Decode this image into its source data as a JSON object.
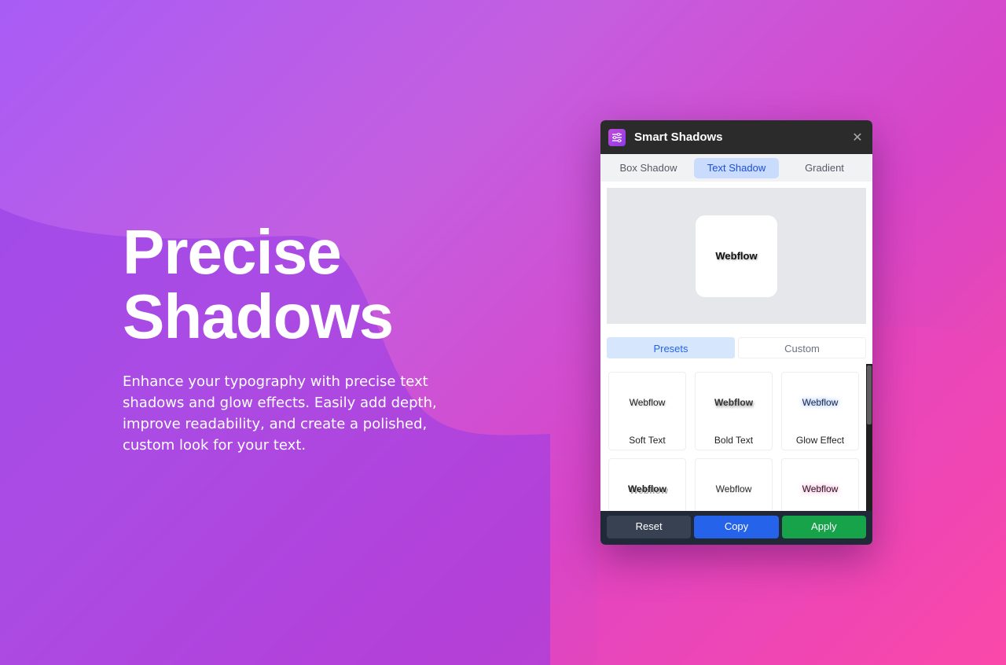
{
  "hero": {
    "title_line1": "Precise",
    "title_line2": "Shadows",
    "description": "Enhance your typography with precise text shadows and glow effects. Easily add depth, improve readability, and create a polished, custom look for your text."
  },
  "panel": {
    "app_title": "Smart Shadows",
    "app_icon": "sliders-icon",
    "close_glyph": "✕",
    "tabs": [
      {
        "label": "Box Shadow",
        "active": false
      },
      {
        "label": "Text Shadow",
        "active": true
      },
      {
        "label": "Gradient",
        "active": false
      }
    ],
    "preview_text": "Webflow",
    "subtabs": [
      {
        "label": "Presets",
        "active": true
      },
      {
        "label": "Custom",
        "active": false
      }
    ],
    "presets": [
      {
        "sample": "Webflow",
        "label": "Soft Text"
      },
      {
        "sample": "Webflow",
        "label": "Bold Text"
      },
      {
        "sample": "Webflow",
        "label": "Glow Effect"
      },
      {
        "sample": "Webflow",
        "label": ""
      },
      {
        "sample": "Webflow",
        "label": ""
      },
      {
        "sample": "Webflow",
        "label": ""
      }
    ],
    "footer": {
      "reset_label": "Reset",
      "copy_label": "Copy",
      "apply_label": "Apply"
    }
  },
  "colors": {
    "accent_blue": "#2563eb",
    "apply_green": "#16a34a",
    "reset_gray": "#374151",
    "titlebar": "#2b2b2b"
  }
}
